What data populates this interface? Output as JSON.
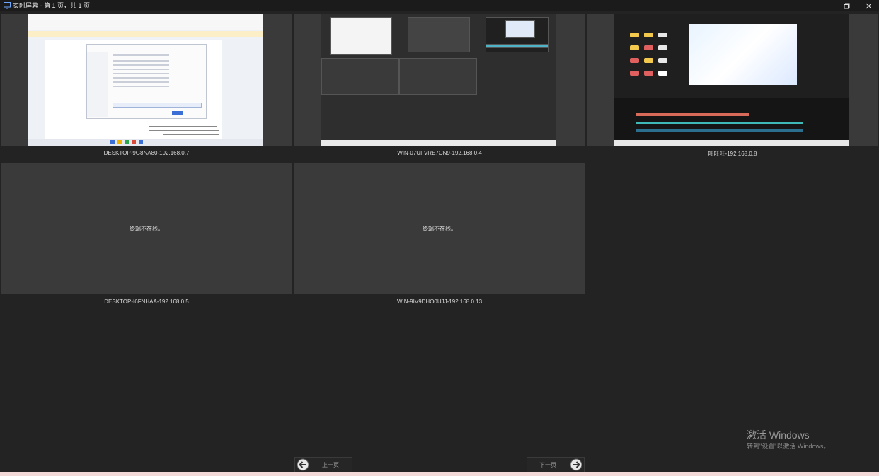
{
  "window": {
    "title": "实时屏幕 - 第 1 页，共 1 页"
  },
  "tiles": [
    {
      "label": "DESKTOP-9G8NA80-192.168.0.7",
      "status": "online"
    },
    {
      "label": "WIN-07UFVRE7CN9-192.168.0.4",
      "status": "online"
    },
    {
      "label": "旺旺旺-192.168.0.8",
      "status": "online"
    },
    {
      "label": "DESKTOP-I6FNHAA-192.168.0.5",
      "status": "offline",
      "message": "终端不在线。"
    },
    {
      "label": "WIN-9IV9DHO0UJJ-192.168.0.13",
      "status": "offline",
      "message": "终端不在线。"
    }
  ],
  "pagination": {
    "prev_label": "上一页",
    "next_label": "下一页"
  },
  "watermark": {
    "line1": "激活 Windows",
    "line2": "转到\"设置\"以激活 Windows。"
  },
  "colors": {
    "background": "#232323",
    "tile": "#3a3a3a",
    "accent": "#3b6fd6"
  },
  "icons": [
    "monitor-icon",
    "minimize-icon",
    "restore-icon",
    "close-icon",
    "arrow-left-circle-icon",
    "arrow-right-circle-icon"
  ]
}
